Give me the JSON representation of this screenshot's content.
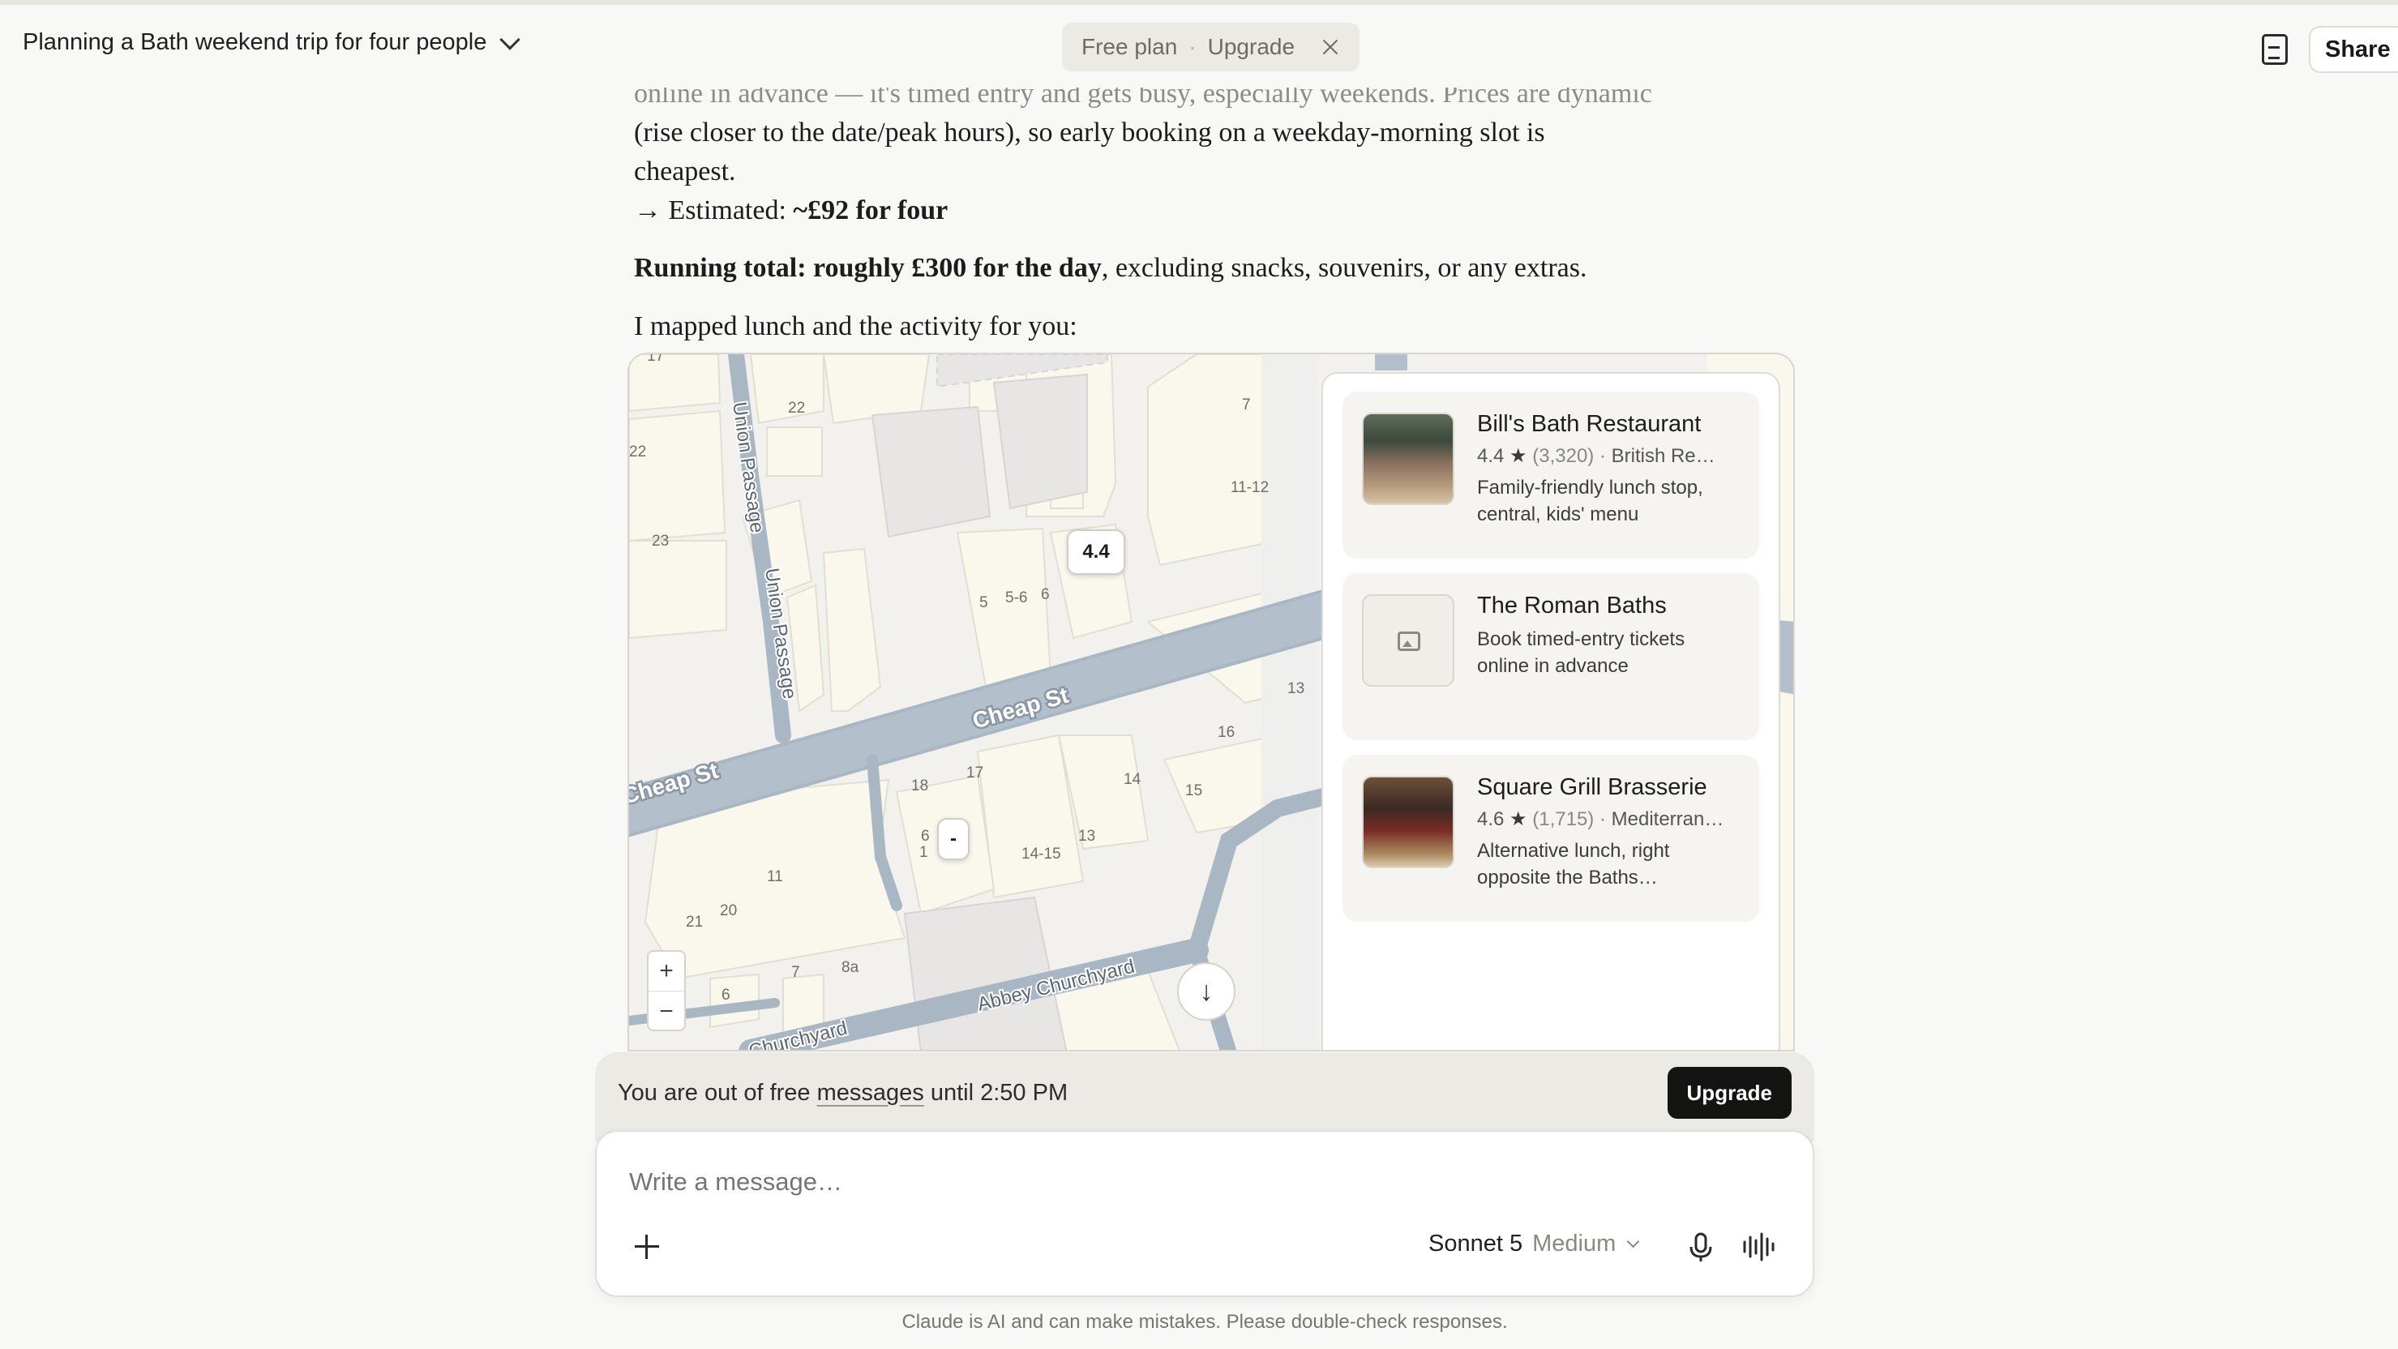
{
  "header": {
    "chat_title": "Planning a Bath weekend trip for four people",
    "plan_label": "Free plan",
    "plan_separator": "·",
    "upgrade_link": "Upgrade",
    "share_label": "Share"
  },
  "message": {
    "line1_faded": "online in advance — it's timed entry and gets busy, especially weekends. Prices are dynamic",
    "line2": "(rise closer to the date/peak hours), so early booking on a weekday-morning slot is",
    "line3": "cheapest.",
    "estimate_prefix": "→ Estimated: ",
    "estimate_value": "~£92 for four",
    "total_bold": "Running total: roughly £300 for the day",
    "total_rest": ", excluding snacks, souvenirs, or any extras.",
    "map_intro": "I mapped lunch and the activity for you:"
  },
  "map": {
    "streets": [
      "Cheap St",
      "Cheap St",
      "Union Passage",
      "Union Passage",
      "Abbey Churchyard",
      "Churchyard"
    ],
    "house_numbers": [
      "17",
      "22",
      "22",
      "23",
      "7",
      "11-12",
      "5",
      "5-6",
      "6",
      "13",
      "16",
      "15",
      "14",
      "17",
      "18",
      "13",
      "14-15",
      "11",
      "20",
      "21",
      "7",
      "8a",
      "6",
      "6",
      "1"
    ],
    "rating_pin": "4.4",
    "minus_pin": "-",
    "zoom_in": "+",
    "zoom_out": "−"
  },
  "places": [
    {
      "name": "Bill's Bath Restaurant",
      "rating": "4.4",
      "count": "(3,320)",
      "category": "British Re…",
      "description": "Family-friendly lunch stop, central, kids' menu"
    },
    {
      "name": "The Roman Baths",
      "description": "Book timed-entry tickets online in advance"
    },
    {
      "name": "Square Grill Brasserie",
      "rating": "4.6",
      "count": "(1,715)",
      "category": "Mediterran…",
      "description": "Alternative lunch, right opposite the Baths…"
    }
  ],
  "limit": {
    "text_before": "You are out of free ",
    "text_link": "messages",
    "text_after": " until 2:50 PM",
    "upgrade_button": "Upgrade"
  },
  "composer": {
    "placeholder": "Write a message…",
    "model": "Sonnet 5",
    "effort": "Medium"
  },
  "disclaimer": "Claude is AI and can make mistakes. Please double-check responses.",
  "icons": {
    "title_chevron": "chevron-down-icon",
    "close": "close-icon",
    "document": "document-icon",
    "star": "star-icon",
    "image_placeholder": "image-icon",
    "plus": "plus-icon",
    "mic": "microphone-icon",
    "voice": "voice-waveform-icon",
    "scroll_down": "arrow-down-icon"
  }
}
